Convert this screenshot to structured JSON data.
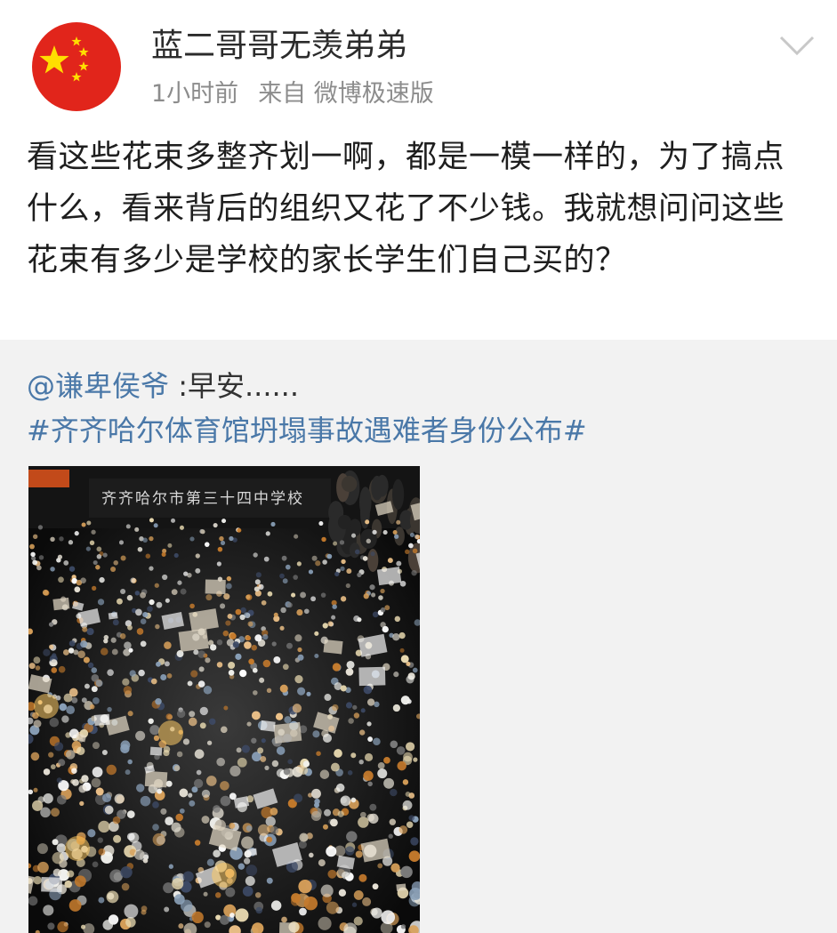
{
  "post": {
    "username": "蓝二哥哥无羡弟弟",
    "time": "1小时前",
    "source": "来自 微博极速版",
    "text": "看这些花束多整齐划一啊，都是一模一样的，为了搞点什么，看来背后的组织又花了不少钱。我就想问问这些花束有多少是学校的家长学生们自己买的？"
  },
  "avatar": {
    "icon": "china-flag-icon",
    "color": "#e1251b",
    "star_color": "#ffde00"
  },
  "repost": {
    "mention": "@谦卑侯爷",
    "text": " :早安......",
    "hashtag": "#齐齐哈尔体育馆坍塌事故遇难者身份公布#"
  },
  "image": {
    "sign_text": "齐齐哈尔市第三十四中学校"
  },
  "colors": {
    "link": "#4a78a8",
    "text": "#1e1e1e",
    "meta": "#8c8c8c",
    "repost_bg": "#f2f2f2"
  }
}
